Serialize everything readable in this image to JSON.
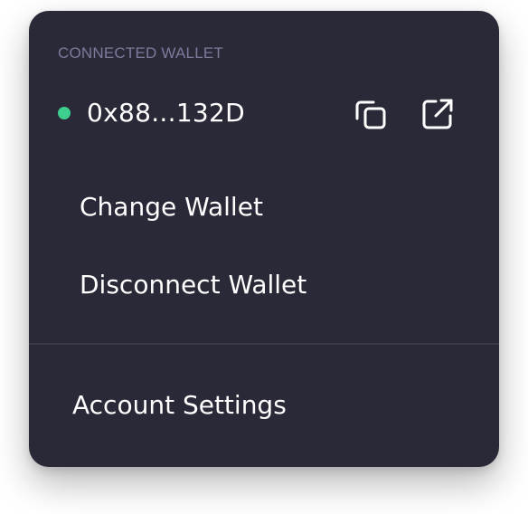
{
  "wallet": {
    "section_label": "CONNECTED WALLET",
    "address": "0x88...132D",
    "status_color": "#3ecf8e",
    "copy_icon": "copy-icon",
    "external_icon": "external-link-icon"
  },
  "menu": {
    "change_wallet": "Change Wallet",
    "disconnect_wallet": "Disconnect Wallet",
    "account_settings": "Account Settings"
  },
  "colors": {
    "panel_background": "#2a2937",
    "label": "#7d7a9c",
    "divider": "#3a394a",
    "text": "#ffffff"
  }
}
